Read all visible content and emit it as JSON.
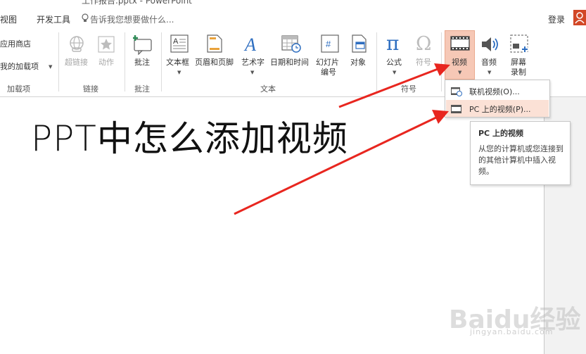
{
  "window": {
    "title": "工作报告.pptx - PowerPoint"
  },
  "tabs": {
    "view": "视图",
    "developer": "开发工具"
  },
  "tell_me": {
    "placeholder": "告诉我您想要做什么..."
  },
  "account": {
    "login": "登录"
  },
  "ribbon": {
    "addins": {
      "store": "应用商店",
      "my_addins": "我的加载项",
      "group": "加载项"
    },
    "links": {
      "hyperlink": "超链接",
      "action": "动作",
      "group": "链接"
    },
    "comments": {
      "comment": "批注",
      "group": "批注"
    },
    "text": {
      "textbox": "文本框",
      "header_footer": "页眉和页脚",
      "wordart": "艺术字",
      "datetime": "日期和时间",
      "slide_number": "幻灯片编号",
      "slide_number_l1": "幻灯片",
      "slide_number_l2": "编号",
      "object": "对象",
      "group": "文本"
    },
    "symbols": {
      "equation": "公式",
      "symbol": "符号",
      "group": "符号"
    },
    "media": {
      "video": "视频",
      "audio": "音频",
      "screen_recording_l1": "屏幕",
      "screen_recording_l2": "录制"
    }
  },
  "video_menu": {
    "online_video": "联机视频(O)...",
    "pc_video": "PC 上的视频(P)..."
  },
  "tooltip": {
    "title": "PC 上的视频",
    "body": "从您的计算机或您连接到的其他计算机中插入视频。"
  },
  "slide": {
    "title": "PPT中怎么添加视频"
  },
  "watermark": {
    "main": "Baidu经验",
    "sub": "jingyan.baidu.com"
  },
  "colors": {
    "accent": "#d24726",
    "highlight": "#f6c8b6",
    "arrow": "#e8261f"
  }
}
